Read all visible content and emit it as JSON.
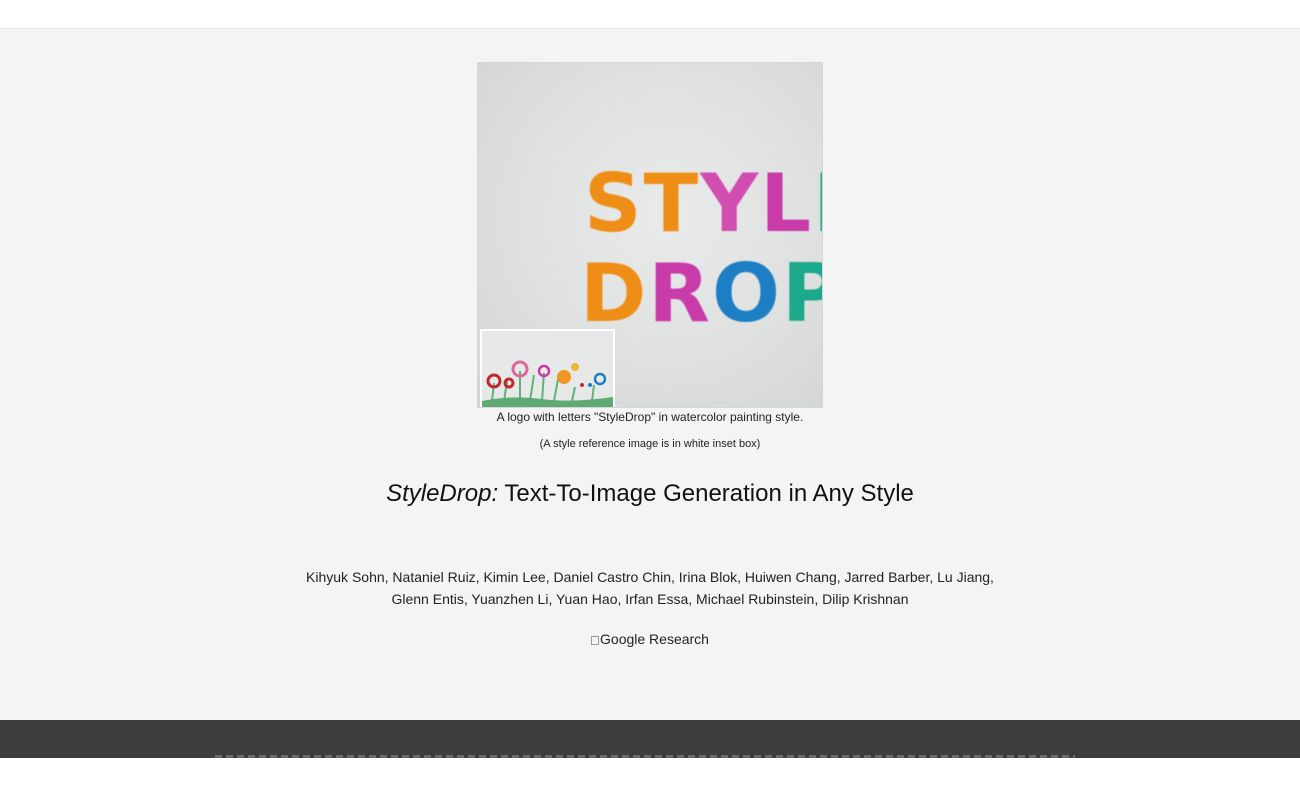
{
  "teaser": {
    "caption": "A logo with letters \"StyleDrop\" in watercolor painting style.",
    "subcaption": "(A style reference image is in white inset box)",
    "logo_line1": "STYLE",
    "logo_line2": "DROP"
  },
  "paper": {
    "title_em": "StyleDrop:",
    "title_rest": " Text-To-Image Generation in Any Style",
    "authors_line1": "Kihyuk Sohn, Nataniel Ruiz, Kimin Lee, Daniel Castro Chin, Irina Blok, Huiwen Chang, Jarred Barber, Lu Jiang,",
    "authors_line2": "Glenn Entis, Yuanzhen Li, Yuan Hao, Irfan Essa, Michael Rubinstein, Dilip Krishnan",
    "affiliation_alt": "Google Research"
  },
  "colors": {
    "hero_bg": "#f4f4f4",
    "dark_band": "#3d3d3d",
    "orange": "#ef8e12",
    "magenta": "#c83aa8",
    "blue": "#1f7fc4",
    "teal": "#1aa88a"
  }
}
